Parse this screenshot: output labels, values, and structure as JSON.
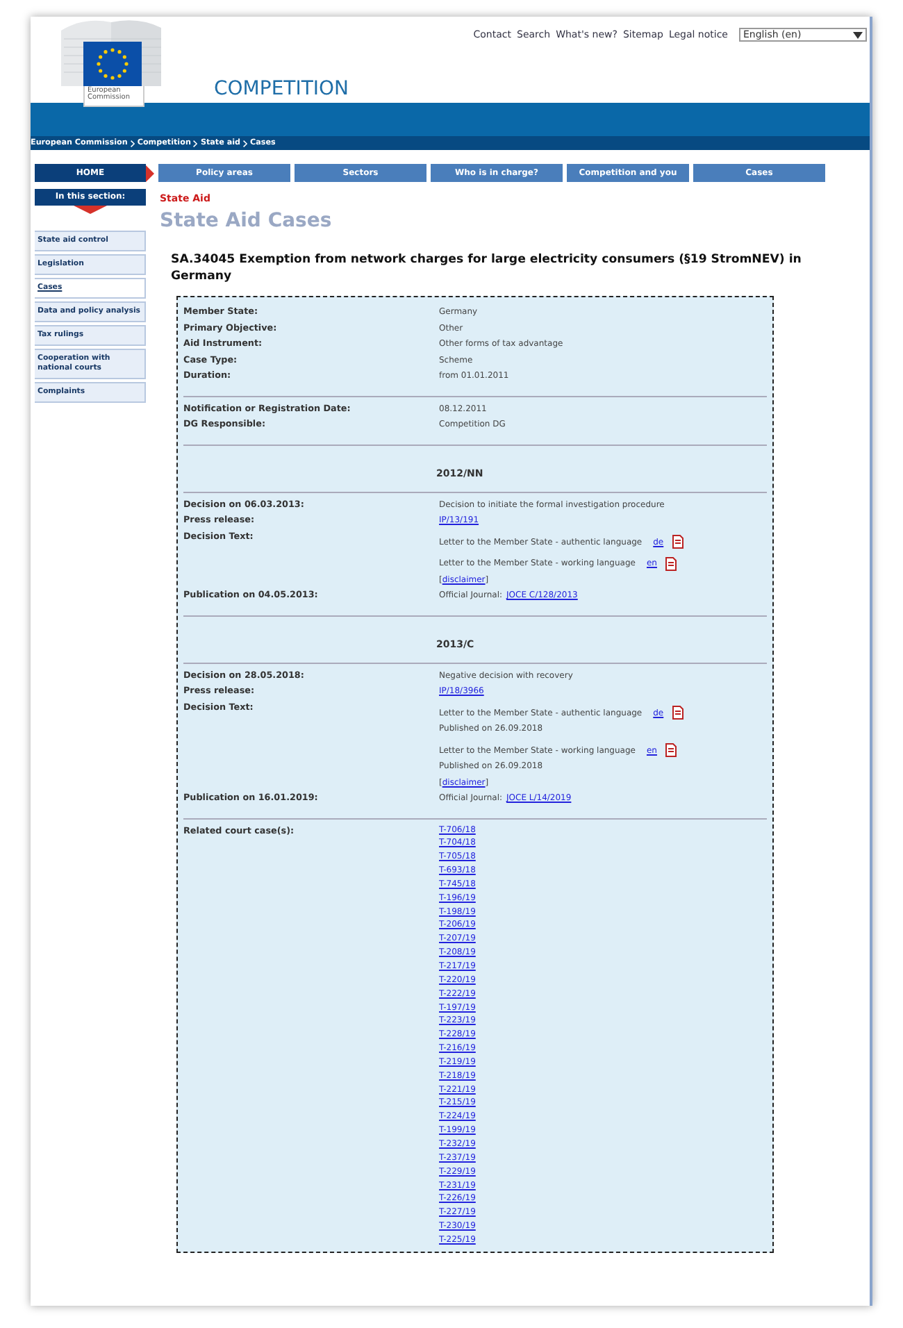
{
  "top_links": [
    "Contact",
    "Search",
    "What's new?",
    "Sitemap",
    "Legal notice"
  ],
  "language": {
    "value": "English (en)"
  },
  "logo": {
    "line1": "European",
    "line2": "Commission"
  },
  "site_title": "COMPETITION",
  "breadcrumb": [
    "European Commission",
    "Competition",
    "State aid",
    "Cases"
  ],
  "nav": {
    "home": "HOME",
    "items": [
      "Policy areas",
      "Sectors",
      "Who is in charge?",
      "Competition and you",
      "Cases"
    ]
  },
  "sidebar": {
    "heading": "In this section:",
    "items": [
      {
        "label": "State aid control",
        "selected": false
      },
      {
        "label": "Legislation",
        "selected": false
      },
      {
        "label": "Cases",
        "selected": true
      },
      {
        "label": "Data and policy analysis",
        "selected": false
      },
      {
        "label": "Tax rulings",
        "selected": false
      },
      {
        "label": "Cooperation with national courts",
        "selected": false
      },
      {
        "label": "Complaints",
        "selected": false
      }
    ]
  },
  "section_label": "State Aid",
  "page_title": "State Aid Cases",
  "case_title": "SA.34045 Exemption from network charges for large electricity consumers (§19 StromNEV) in Germany",
  "blocks": [
    {
      "kind": "rows",
      "rows": [
        {
          "label": "Member State:",
          "items": [
            {
              "kind": "text",
              "text": "Germany"
            }
          ]
        },
        {
          "label": "Primary Objective:",
          "items": [
            {
              "kind": "text",
              "text": "Other"
            }
          ]
        },
        {
          "label": "Aid Instrument:",
          "items": [
            {
              "kind": "text",
              "text": "Other forms of tax advantage"
            }
          ]
        },
        {
          "label": "Case Type:",
          "items": [
            {
              "kind": "text",
              "text": "Scheme"
            }
          ]
        },
        {
          "label": "Duration:",
          "items": [
            {
              "kind": "text",
              "text": "from 01.01.2011"
            }
          ]
        }
      ]
    },
    {
      "kind": "rows",
      "rows": [
        {
          "label": "Notification or Registration Date:",
          "items": [
            {
              "kind": "text",
              "text": "08.12.2011"
            }
          ]
        },
        {
          "label": "DG Responsible:",
          "items": [
            {
              "kind": "text",
              "text": "Competition DG"
            }
          ]
        }
      ]
    },
    {
      "kind": "heading",
      "text": "2012/NN"
    },
    {
      "kind": "rows",
      "rows": [
        {
          "label": "Decision on 06.03.2013:",
          "items": [
            {
              "kind": "text",
              "text": "Decision to initiate the formal investigation procedure"
            }
          ]
        },
        {
          "label": "Press release:",
          "items": [
            {
              "kind": "link",
              "text": "IP/13/191"
            }
          ]
        },
        {
          "label": "Decision Text:",
          "items": [
            {
              "kind": "doc",
              "text": "Letter to the Member State - authentic language",
              "lang": "de"
            },
            {
              "kind": "doc",
              "text": "Letter to the Member State - working language",
              "lang": "en",
              "disclaimer": {
                "before": "[",
                "link": "disclaimer",
                "after": "]"
              }
            }
          ]
        },
        {
          "label": "Publication on 04.05.2013:",
          "items": [
            {
              "kind": "journal",
              "text": "Official Journal:",
              "link": "JOCE C/128/2013"
            }
          ]
        }
      ]
    },
    {
      "kind": "heading",
      "text": "2013/C"
    },
    {
      "kind": "rows",
      "rows": [
        {
          "label": "Decision on 28.05.2018:",
          "items": [
            {
              "kind": "text",
              "text": "Negative decision with recovery"
            }
          ]
        },
        {
          "label": "Press release:",
          "items": [
            {
              "kind": "link",
              "text": "IP/18/3966"
            }
          ]
        },
        {
          "label": "Decision Text:",
          "items": [
            {
              "kind": "doc",
              "text": "Letter to the Member State - authentic language",
              "lang": "de",
              "published": "Published on 26.09.2018"
            },
            {
              "kind": "doc",
              "text": "Letter to the Member State - working language",
              "lang": "en",
              "published": "Published on 26.09.2018",
              "disclaimer": {
                "before": "[",
                "link": "disclaimer",
                "after": "]"
              }
            }
          ]
        },
        {
          "label": "Publication on 16.01.2019:",
          "items": [
            {
              "kind": "journal",
              "text": "Official Journal:",
              "link": "JOCE L/14/2019"
            }
          ]
        }
      ]
    },
    {
      "kind": "rows",
      "rows": [
        {
          "label": "Related court case(s):",
          "items": [
            {
              "kind": "linklist",
              "links": [
                "T-706/18",
                "T-704/18",
                "T-705/18",
                "T-693/18",
                "T-745/18",
                "T-196/19",
                "T-198/19",
                "T-206/19",
                "T-207/19",
                "T-208/19",
                "T-217/19",
                "T-220/19",
                "T-222/19",
                "T-197/19",
                "T-223/19",
                "T-228/19",
                "T-216/19",
                "T-219/19",
                "T-218/19",
                "T-221/19",
                "T-215/19",
                "T-224/19",
                "T-199/19",
                "T-232/19",
                "T-237/19",
                "T-229/19",
                "T-231/19",
                "T-226/19",
                "T-227/19",
                "T-230/19",
                "T-225/19"
              ]
            }
          ]
        }
      ]
    }
  ]
}
